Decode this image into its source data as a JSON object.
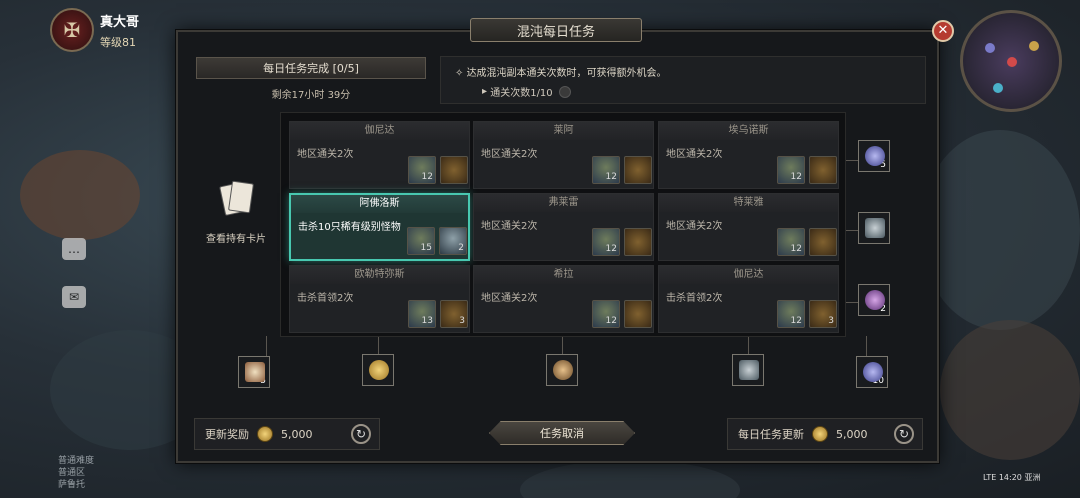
{
  "hud": {
    "player_name": "真大哥",
    "player_level": "等级81",
    "world_texts": [
      "普通难度",
      "普通区",
      "萨鲁托"
    ],
    "status_network": "LTE",
    "status_time": "14:20 亚洲"
  },
  "panel": {
    "title": "混沌每日任务",
    "progress_label": "每日任务完成 [0/5]",
    "remaining": "剩余17小时 39分",
    "bonus_desc": "达成混沌副本通关次数时，可获得额外机会。",
    "bonus_progress": "通关次数1/10",
    "view_cards": "查看持有卡片"
  },
  "tasks": [
    {
      "name": "伽尼达",
      "desc": "地区通关2次",
      "r1": "exp",
      "r1_count": "12",
      "r2": "chest",
      "r2_count": ""
    },
    {
      "name": "莱阿",
      "desc": "地区通关2次",
      "r1": "exp",
      "r1_count": "12",
      "r2": "chest",
      "r2_count": ""
    },
    {
      "name": "埃乌诺斯",
      "desc": "地区通关2次",
      "r1": "exp",
      "r1_count": "12",
      "r2": "chest",
      "r2_count": ""
    },
    {
      "name": "阿佛洛斯",
      "desc": "击杀10只稀有级别怪物",
      "r1": "exp",
      "r1_count": "15",
      "r2": "shard",
      "r2_count": "2",
      "active": true
    },
    {
      "name": "弗莱雷",
      "desc": "地区通关2次",
      "r1": "exp",
      "r1_count": "12",
      "r2": "chest",
      "r2_count": ""
    },
    {
      "name": "特莱雅",
      "desc": "地区通关2次",
      "r1": "exp",
      "r1_count": "12",
      "r2": "chest",
      "r2_count": ""
    },
    {
      "name": "欧勒特弥斯",
      "desc": "击杀首领2次",
      "r1": "exp",
      "r1_count": "13",
      "r2": "chest",
      "r2_count": "3"
    },
    {
      "name": "希拉",
      "desc": "地区通关2次",
      "r1": "exp",
      "r1_count": "12",
      "r2": "chest",
      "r2_count": ""
    },
    {
      "name": "伽尼达",
      "desc": "击杀首领2次",
      "r1": "exp",
      "r1_count": "12",
      "r2": "chest",
      "r2_count": "3"
    }
  ],
  "line_rewards": {
    "row1": "5",
    "row2": "",
    "row3": "2",
    "bottom": [
      "5",
      "",
      "",
      "",
      "10"
    ]
  },
  "footer": {
    "refresh_reward_label": "更新奖励",
    "refresh_reward_cost": "5,000",
    "cancel_label": "任务取消",
    "daily_refresh_label": "每日任务更新",
    "daily_refresh_cost": "5,000"
  },
  "colors": {
    "active_border": "#48c8b0",
    "close_button": "#b53b30"
  }
}
